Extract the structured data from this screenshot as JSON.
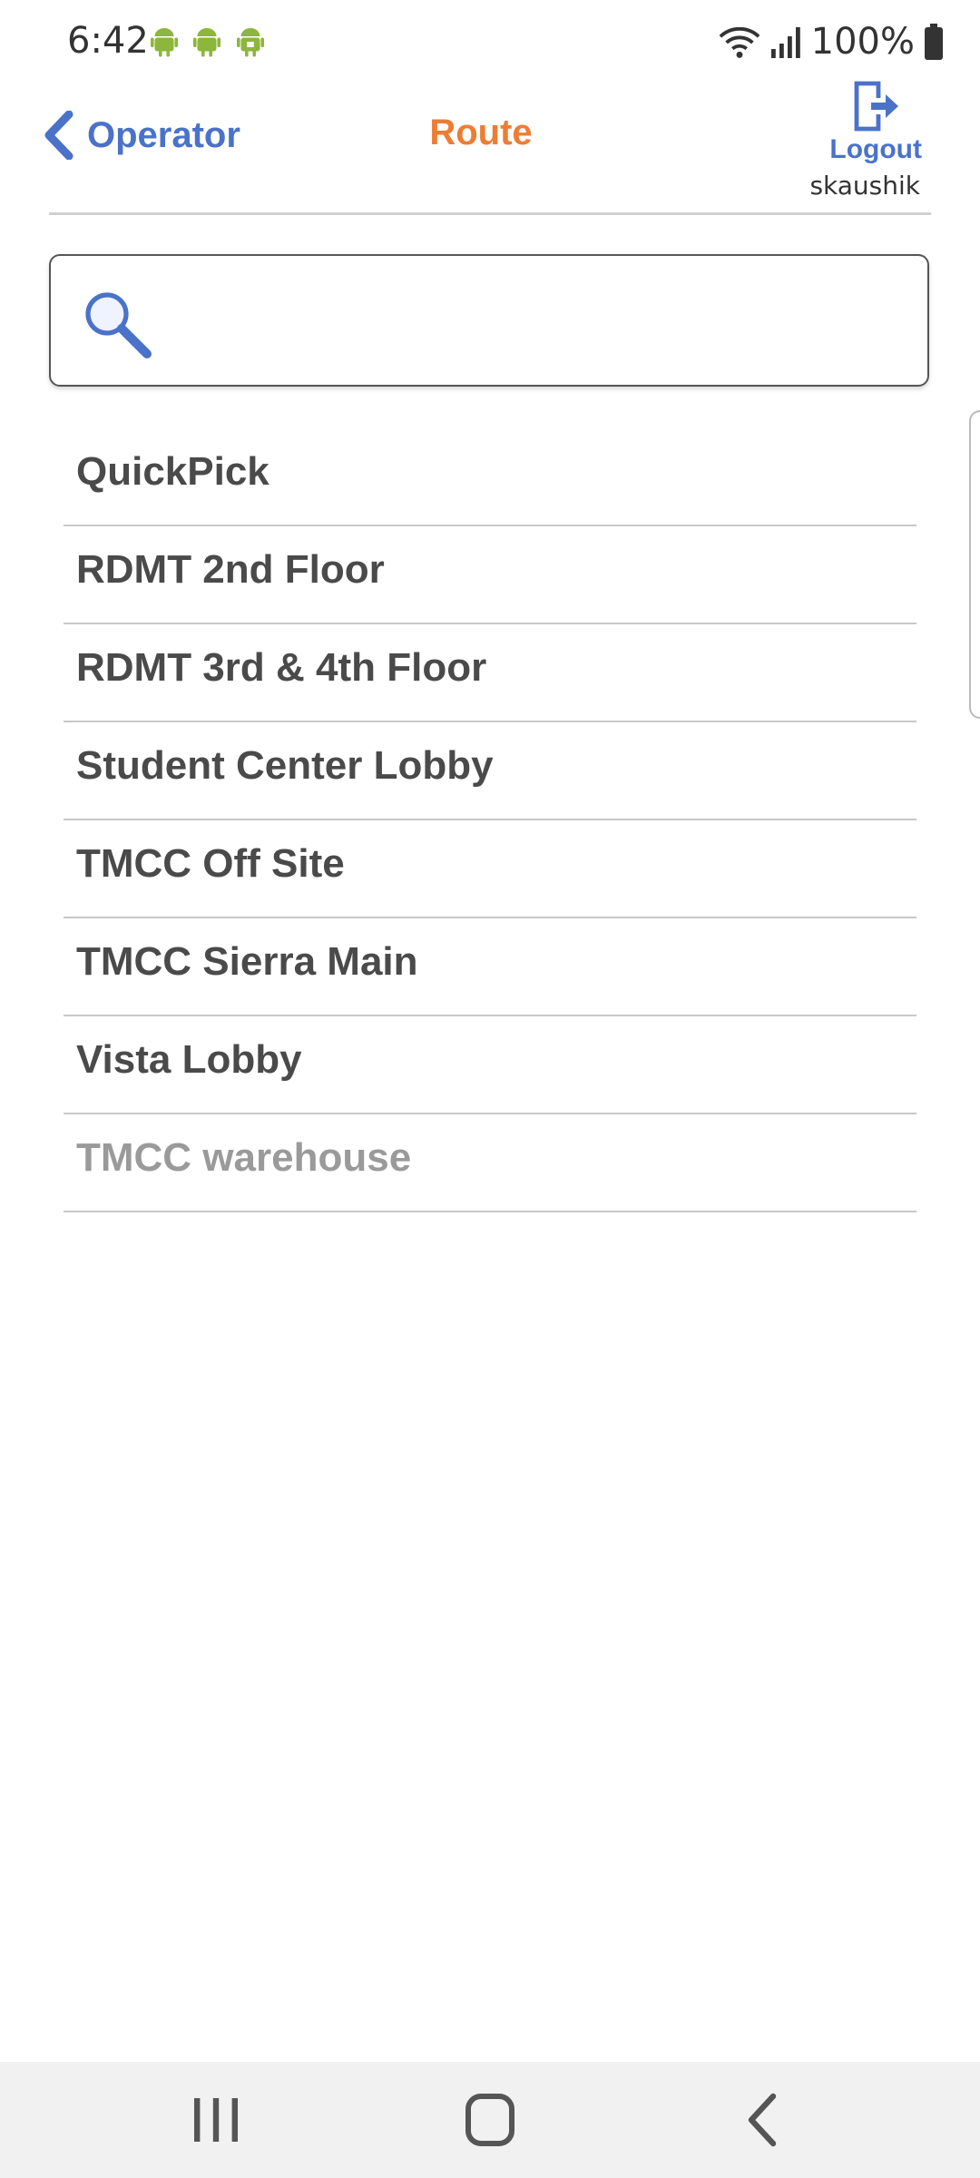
{
  "status_bar": {
    "time": "6:42",
    "battery_percent": "100%",
    "notification_icons": [
      "android-icon",
      "android-icon",
      "android-lock-icon"
    ],
    "icons": [
      "wifi-icon",
      "signal-icon",
      "battery-icon"
    ]
  },
  "header": {
    "back_label": "Operator",
    "title": "Route",
    "logout_label": "Logout",
    "username": "skaushik"
  },
  "search": {
    "value": "",
    "placeholder": ""
  },
  "routes": [
    {
      "label": "QuickPick"
    },
    {
      "label": "RDMT 2nd Floor"
    },
    {
      "label": "RDMT 3rd & 4th Floor"
    },
    {
      "label": "Student Center Lobby"
    },
    {
      "label": "TMCC Off Site"
    },
    {
      "label": "TMCC Sierra Main"
    },
    {
      "label": "Vista Lobby"
    },
    {
      "label": "TMCC warehouse"
    }
  ],
  "colors": {
    "accent_blue": "#4a72c9",
    "title_orange": "#ee7d34",
    "text_dark": "#4a4a4a",
    "text_muted": "#9a9a9a",
    "android_green": "#8cb63c"
  }
}
